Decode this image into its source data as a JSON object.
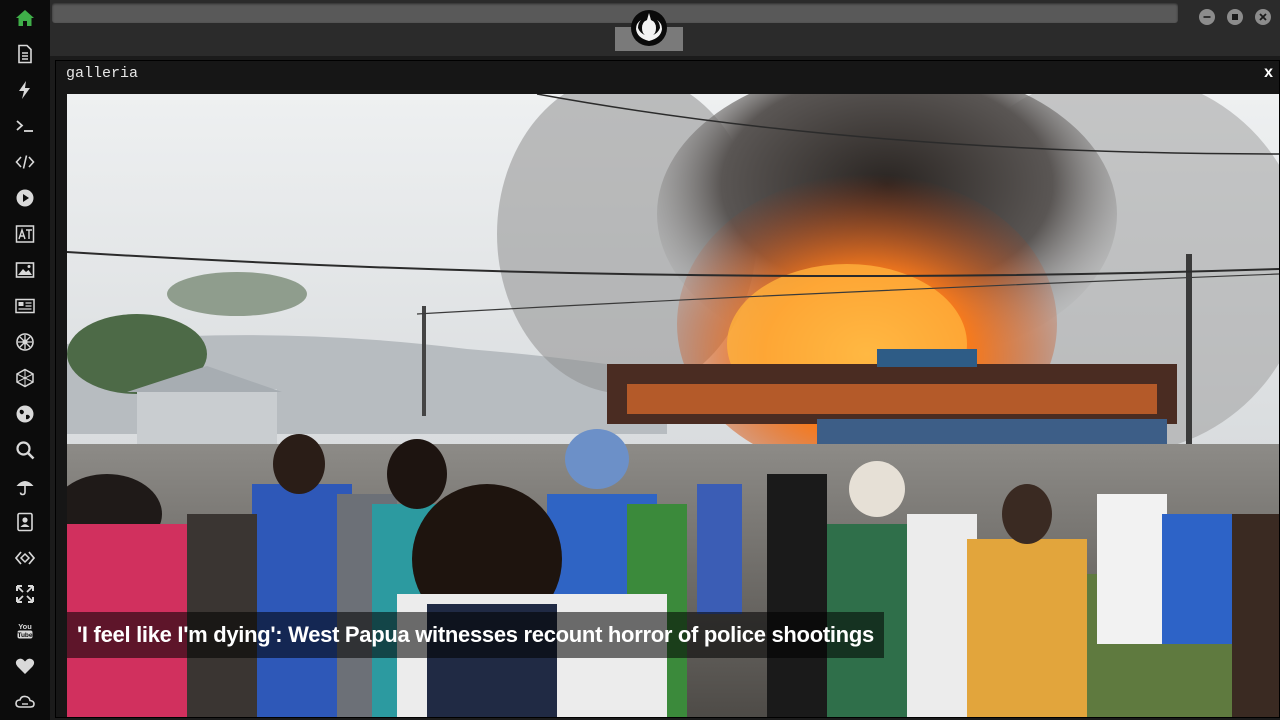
{
  "colors": {
    "sidebar_bg": "#0c0c0c",
    "active_icon": "#3fae49",
    "icon": "#d9d9d9",
    "topbar_bg": "#2b2b2b",
    "window_buttons": "#8c8c8c"
  },
  "sidebar": {
    "items": [
      {
        "icon": "home-icon",
        "active": true
      },
      {
        "icon": "document-icon"
      },
      {
        "icon": "lightning-icon"
      },
      {
        "icon": "terminal-icon"
      },
      {
        "icon": "code-icon"
      },
      {
        "icon": "play-icon"
      },
      {
        "icon": "translate-icon"
      },
      {
        "icon": "image-icon"
      },
      {
        "icon": "newspaper-icon"
      },
      {
        "icon": "settings-wheel-icon"
      },
      {
        "icon": "hexagon-icon"
      },
      {
        "icon": "globe-icon"
      },
      {
        "icon": "search-icon"
      },
      {
        "icon": "umbrella-icon"
      },
      {
        "icon": "contact-icon"
      },
      {
        "icon": "code-diamond-icon"
      },
      {
        "icon": "expand-icon"
      },
      {
        "icon": "youtube-icon"
      },
      {
        "icon": "heart-icon"
      },
      {
        "icon": "cloud-link-icon"
      }
    ]
  },
  "topbar": {
    "logo_icon": "rebel-alliance-icon",
    "window_controls": [
      "minimize-icon",
      "maximize-icon",
      "close-icon"
    ]
  },
  "gallery": {
    "title": "galleria",
    "close_label": "x",
    "caption": "'I feel like I'm dying': West Papua witnesses recount horror of police shootings"
  }
}
